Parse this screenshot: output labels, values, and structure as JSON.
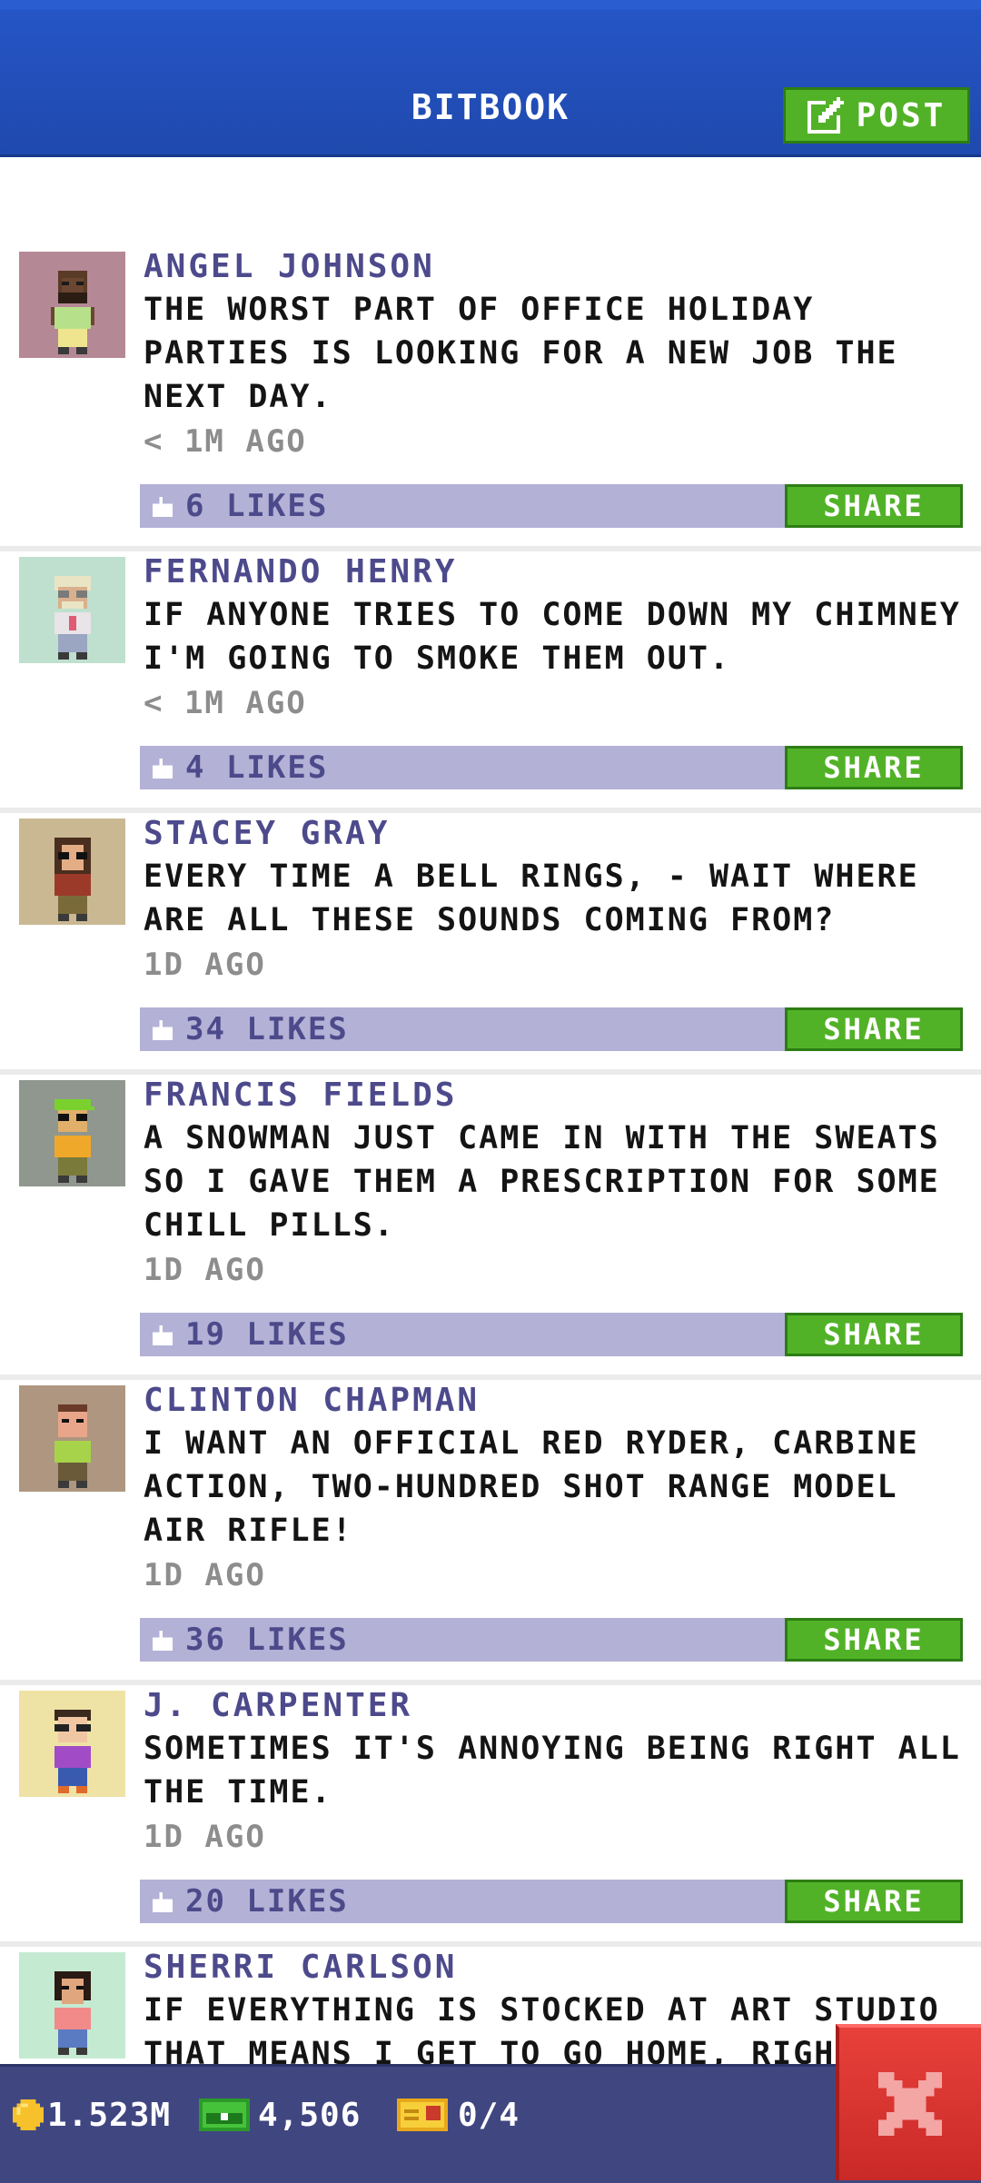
{
  "header": {
    "title": "BITBOOK",
    "post_label": "POST",
    "post_icon": "edit-icon",
    "colors": {
      "bar": "#1f49ad",
      "button": "#52b227"
    }
  },
  "posts": [
    {
      "name": "ANGEL JOHNSON",
      "text": "THE WORST PART OF OFFICE HOLIDAY PARTIES IS LOOKING FOR A NEW JOB THE NEXT DAY.",
      "time": "< 1M AGO",
      "likes": "6 LIKES",
      "share": "SHARE",
      "avatar_bg": "#b58896"
    },
    {
      "name": "FERNANDO HENRY",
      "text": "IF ANYONE TRIES TO COME DOWN MY CHIMNEY I'M GOING TO SMOKE THEM OUT.",
      "time": "< 1M AGO",
      "likes": "4 LIKES",
      "share": "SHARE",
      "avatar_bg": "#bfe0ce"
    },
    {
      "name": "STACEY GRAY",
      "text": "EVERY TIME A BELL RINGS, - WAIT WHERE ARE ALL THESE SOUNDS COMING FROM?",
      "time": "1D AGO",
      "likes": "34 LIKES",
      "share": "SHARE",
      "avatar_bg": "#c9b892"
    },
    {
      "name": "FRANCIS FIELDS",
      "text": "A SNOWMAN JUST CAME IN WITH THE SWEATS SO I GAVE THEM A PRESCRIPTION FOR SOME CHILL PILLS.",
      "time": "1D AGO",
      "likes": "19 LIKES",
      "share": "SHARE",
      "avatar_bg": "#8f978f"
    },
    {
      "name": "CLINTON CHAPMAN",
      "text": "I WANT AN OFFICIAL RED RYDER, CARBINE ACTION, TWO-HUNDRED SHOT RANGE MODEL AIR RIFLE!",
      "time": "1D AGO",
      "likes": "36 LIKES",
      "share": "SHARE",
      "avatar_bg": "#ae9680"
    },
    {
      "name": "J. CARPENTER",
      "text": "SOMETIMES IT'S ANNOYING BEING RIGHT ALL THE TIME.",
      "time": "1D AGO",
      "likes": "20 LIKES",
      "share": "SHARE",
      "avatar_bg": "#efe2a5"
    },
    {
      "name": "SHERRI CARLSON",
      "text": "IF EVERYTHING IS STOCKED AT ART STUDIO THAT MEANS I GET TO GO HOME, RIGHT?",
      "time": "",
      "likes": "",
      "share": "",
      "avatar_bg": "#c4ead2"
    }
  ],
  "bottom_bar": {
    "coins": "1.523M",
    "bux": "4,506",
    "tickets": "0/4",
    "icons": [
      "coin-icon",
      "bux-icon",
      "ticket-icon"
    ],
    "close_icon": "close-icon",
    "colors": {
      "bar": "#404680",
      "close": "#d9332f"
    }
  }
}
